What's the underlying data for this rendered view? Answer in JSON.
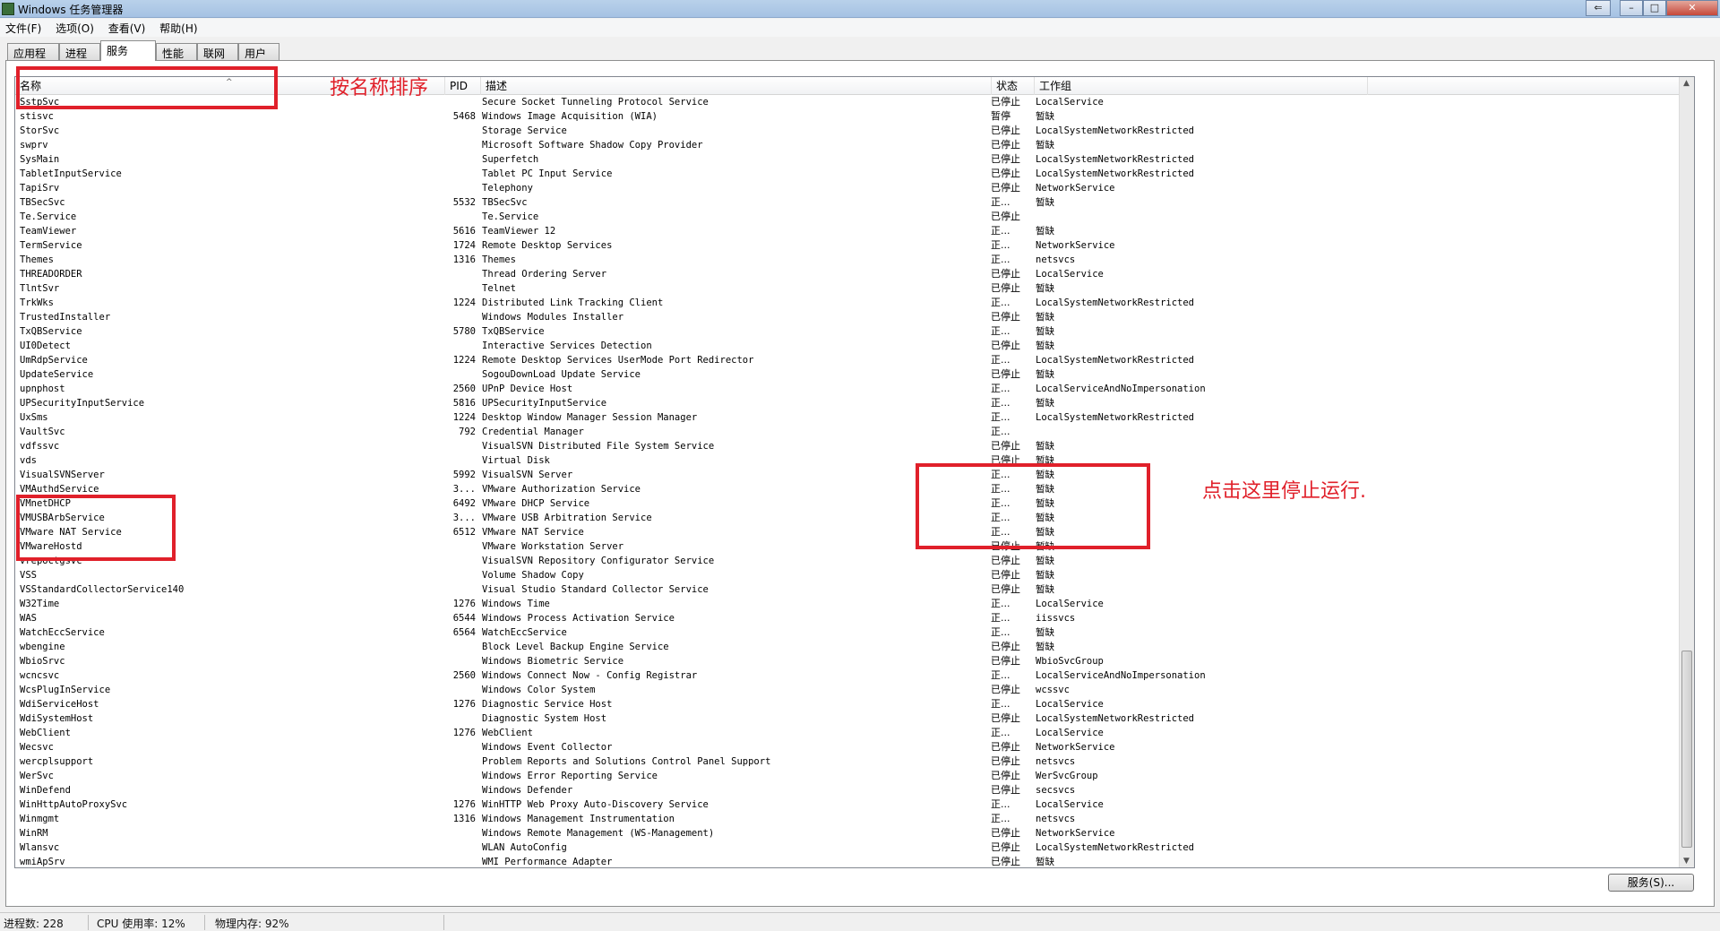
{
  "window": {
    "title": "Windows 任务管理器",
    "buttons": {
      "extra": "⇐",
      "minimize": "–",
      "maximize": "□",
      "close": "✕"
    }
  },
  "menu": [
    "文件(F)",
    "选项(O)",
    "查看(V)",
    "帮助(H)"
  ],
  "tabs": [
    "应用程序",
    "进程",
    "服务",
    "性能",
    "联网",
    "用户"
  ],
  "active_tab": "服务",
  "columns": {
    "name": "名称",
    "pid": "PID",
    "desc": "描述",
    "status": "状态",
    "group": "工作组"
  },
  "rows": [
    {
      "name": "SstpSvc",
      "pid": "",
      "desc": "Secure Socket Tunneling Protocol Service",
      "status": "已停止",
      "group": "LocalService"
    },
    {
      "name": "stisvc",
      "pid": "5468",
      "desc": "Windows Image Acquisition (WIA)",
      "status": "暂停",
      "group": "暂缺"
    },
    {
      "name": "StorSvc",
      "pid": "",
      "desc": "Storage Service",
      "status": "已停止",
      "group": "LocalSystemNetworkRestricted"
    },
    {
      "name": "swprv",
      "pid": "",
      "desc": "Microsoft Software Shadow Copy Provider",
      "status": "已停止",
      "group": "暂缺"
    },
    {
      "name": "SysMain",
      "pid": "",
      "desc": "Superfetch",
      "status": "已停止",
      "group": "LocalSystemNetworkRestricted"
    },
    {
      "name": "TabletInputService",
      "pid": "",
      "desc": "Tablet PC Input Service",
      "status": "已停止",
      "group": "LocalSystemNetworkRestricted"
    },
    {
      "name": "TapiSrv",
      "pid": "",
      "desc": "Telephony",
      "status": "已停止",
      "group": "NetworkService"
    },
    {
      "name": "TBSecSvc",
      "pid": "5532",
      "desc": "TBSecSvc",
      "status": "正...",
      "group": "暂缺"
    },
    {
      "name": "Te.Service",
      "pid": "",
      "desc": "Te.Service",
      "status": "已停止",
      "group": ""
    },
    {
      "name": "TeamViewer",
      "pid": "5616",
      "desc": "TeamViewer 12",
      "status": "正...",
      "group": "暂缺"
    },
    {
      "name": "TermService",
      "pid": "1724",
      "desc": "Remote Desktop Services",
      "status": "正...",
      "group": "NetworkService"
    },
    {
      "name": "Themes",
      "pid": "1316",
      "desc": "Themes",
      "status": "正...",
      "group": "netsvcs"
    },
    {
      "name": "THREADORDER",
      "pid": "",
      "desc": "Thread Ordering Server",
      "status": "已停止",
      "group": "LocalService"
    },
    {
      "name": "TlntSvr",
      "pid": "",
      "desc": "Telnet",
      "status": "已停止",
      "group": "暂缺"
    },
    {
      "name": "TrkWks",
      "pid": "1224",
      "desc": "Distributed Link Tracking Client",
      "status": "正...",
      "group": "LocalSystemNetworkRestricted"
    },
    {
      "name": "TrustedInstaller",
      "pid": "",
      "desc": "Windows Modules Installer",
      "status": "已停止",
      "group": "暂缺"
    },
    {
      "name": "TxQBService",
      "pid": "5780",
      "desc": "TxQBService",
      "status": "正...",
      "group": "暂缺"
    },
    {
      "name": "UI0Detect",
      "pid": "",
      "desc": "Interactive Services Detection",
      "status": "已停止",
      "group": "暂缺"
    },
    {
      "name": "UmRdpService",
      "pid": "1224",
      "desc": "Remote Desktop Services UserMode Port Redirector",
      "status": "正...",
      "group": "LocalSystemNetworkRestricted"
    },
    {
      "name": "UpdateService",
      "pid": "",
      "desc": "SogouDownLoad Update Service",
      "status": "已停止",
      "group": "暂缺"
    },
    {
      "name": "upnphost",
      "pid": "2560",
      "desc": "UPnP Device Host",
      "status": "正...",
      "group": "LocalServiceAndNoImpersonation"
    },
    {
      "name": "UPSecurityInputService",
      "pid": "5816",
      "desc": "UPSecurityInputService",
      "status": "正...",
      "group": "暂缺"
    },
    {
      "name": "UxSms",
      "pid": "1224",
      "desc": "Desktop Window Manager Session Manager",
      "status": "正...",
      "group": "LocalSystemNetworkRestricted"
    },
    {
      "name": "VaultSvc",
      "pid": "792",
      "desc": "Credential Manager",
      "status": "正...",
      "group": ""
    },
    {
      "name": "vdfssvc",
      "pid": "",
      "desc": "VisualSVN Distributed File System Service",
      "status": "已停止",
      "group": "暂缺"
    },
    {
      "name": "vds",
      "pid": "",
      "desc": "Virtual Disk",
      "status": "已停止",
      "group": "暂缺"
    },
    {
      "name": "VisualSVNServer",
      "pid": "5992",
      "desc": "VisualSVN Server",
      "status": "正...",
      "group": "暂缺"
    },
    {
      "name": "VMAuthdService",
      "pid": "3...",
      "desc": "VMware Authorization Service",
      "status": "正...",
      "group": "暂缺"
    },
    {
      "name": "VMnetDHCP",
      "pid": "6492",
      "desc": "VMware DHCP Service",
      "status": "正...",
      "group": "暂缺"
    },
    {
      "name": "VMUSBArbService",
      "pid": "3...",
      "desc": "VMware USB Arbitration Service",
      "status": "正...",
      "group": "暂缺"
    },
    {
      "name": "VMware NAT Service",
      "pid": "6512",
      "desc": "VMware NAT Service",
      "status": "正...",
      "group": "暂缺"
    },
    {
      "name": "VMwareHostd",
      "pid": "",
      "desc": "VMware Workstation Server",
      "status": "已停止",
      "group": "暂缺"
    },
    {
      "name": "vrepoctgsvc",
      "pid": "",
      "desc": "VisualSVN Repository Configurator Service",
      "status": "已停止",
      "group": "暂缺"
    },
    {
      "name": "VSS",
      "pid": "",
      "desc": "Volume Shadow Copy",
      "status": "已停止",
      "group": "暂缺"
    },
    {
      "name": "VSStandardCollectorService140",
      "pid": "",
      "desc": "Visual Studio Standard Collector Service",
      "status": "已停止",
      "group": "暂缺"
    },
    {
      "name": "W32Time",
      "pid": "1276",
      "desc": "Windows Time",
      "status": "正...",
      "group": "LocalService"
    },
    {
      "name": "WAS",
      "pid": "6544",
      "desc": "Windows Process Activation Service",
      "status": "正...",
      "group": "iissvcs"
    },
    {
      "name": "WatchEccService",
      "pid": "6564",
      "desc": "WatchEccService",
      "status": "正...",
      "group": "暂缺"
    },
    {
      "name": "wbengine",
      "pid": "",
      "desc": "Block Level Backup Engine Service",
      "status": "已停止",
      "group": "暂缺"
    },
    {
      "name": "WbioSrvc",
      "pid": "",
      "desc": "Windows Biometric Service",
      "status": "已停止",
      "group": "WbioSvcGroup"
    },
    {
      "name": "wcncsvc",
      "pid": "2560",
      "desc": "Windows Connect Now - Config Registrar",
      "status": "正...",
      "group": "LocalServiceAndNoImpersonation"
    },
    {
      "name": "WcsPlugInService",
      "pid": "",
      "desc": "Windows Color System",
      "status": "已停止",
      "group": "wcssvc"
    },
    {
      "name": "WdiServiceHost",
      "pid": "1276",
      "desc": "Diagnostic Service Host",
      "status": "正...",
      "group": "LocalService"
    },
    {
      "name": "WdiSystemHost",
      "pid": "",
      "desc": "Diagnostic System Host",
      "status": "已停止",
      "group": "LocalSystemNetworkRestricted"
    },
    {
      "name": "WebClient",
      "pid": "1276",
      "desc": "WebClient",
      "status": "正...",
      "group": "LocalService"
    },
    {
      "name": "Wecsvc",
      "pid": "",
      "desc": "Windows Event Collector",
      "status": "已停止",
      "group": "NetworkService"
    },
    {
      "name": "wercplsupport",
      "pid": "",
      "desc": "Problem Reports and Solutions Control Panel Support",
      "status": "已停止",
      "group": "netsvcs"
    },
    {
      "name": "WerSvc",
      "pid": "",
      "desc": "Windows Error Reporting Service",
      "status": "已停止",
      "group": "WerSvcGroup"
    },
    {
      "name": "WinDefend",
      "pid": "",
      "desc": "Windows Defender",
      "status": "已停止",
      "group": "secsvcs"
    },
    {
      "name": "WinHttpAutoProxySvc",
      "pid": "1276",
      "desc": "WinHTTP Web Proxy Auto-Discovery Service",
      "status": "正...",
      "group": "LocalService"
    },
    {
      "name": "Winmgmt",
      "pid": "1316",
      "desc": "Windows Management Instrumentation",
      "status": "正...",
      "group": "netsvcs"
    },
    {
      "name": "WinRM",
      "pid": "",
      "desc": "Windows Remote Management (WS-Management)",
      "status": "已停止",
      "group": "NetworkService"
    },
    {
      "name": "Wlansvc",
      "pid": "",
      "desc": "WLAN AutoConfig",
      "status": "已停止",
      "group": "LocalSystemNetworkRestricted"
    },
    {
      "name": "wmiApSrv",
      "pid": "",
      "desc": "WMI Performance Adapter",
      "status": "已停止",
      "group": "暂缺"
    }
  ],
  "services_button": "服务(S)...",
  "statusbar": {
    "processes": "进程数: 228",
    "cpu": "CPU 使用率: 12%",
    "memory": "物理内存: 92%"
  },
  "annotations": {
    "sort_hint": "按名称排序",
    "stop_hint": "点击这里停止运行.",
    "color": "#e0202a"
  }
}
